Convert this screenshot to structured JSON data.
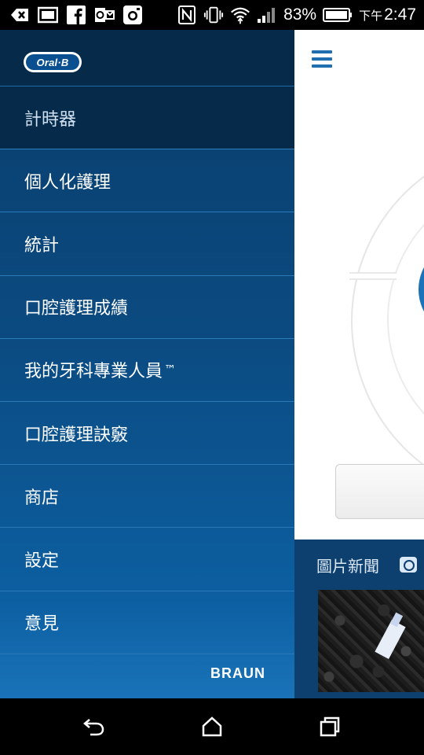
{
  "status_bar": {
    "battery_percent": "83%",
    "time_prefix": "下午",
    "time": "2:47",
    "left_icons": [
      "back-arrow-icon",
      "image-icon",
      "facebook-icon",
      "outlook-icon",
      "instagram-icon"
    ],
    "right_icons": [
      "nfc-icon",
      "vibrate-icon",
      "wifi-icon",
      "signal-icon",
      "battery-icon"
    ]
  },
  "drawer": {
    "logo_text": "Oral·B",
    "brand_footer": "BRAUN",
    "items": [
      {
        "label": "計時器",
        "active": true
      },
      {
        "label": "個人化護理"
      },
      {
        "label": "統計"
      },
      {
        "label": "口腔護理成績"
      },
      {
        "label": "我的牙科專業人員",
        "suffix": "™"
      },
      {
        "label": "口腔護理訣竅"
      },
      {
        "label": "商店"
      },
      {
        "label": "設定"
      },
      {
        "label": "意見"
      }
    ]
  },
  "main": {
    "news_title": "圖片新聞"
  },
  "colors": {
    "drawer_top": "#0a3d6b",
    "drawer_bottom": "#1a73b8",
    "active_item": "#062a4a",
    "accent_blue": "#1a72b8"
  }
}
